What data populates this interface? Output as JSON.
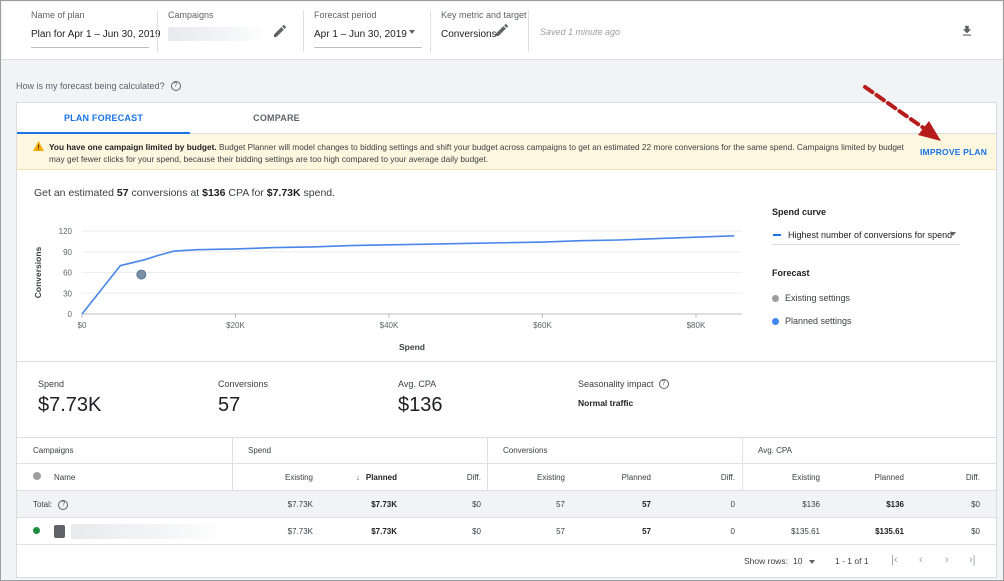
{
  "topbar": {
    "plan_name_label": "Name of plan",
    "plan_name_value": "Plan for Apr 1 – Jun 30, 2019",
    "campaigns_label": "Campaigns",
    "forecast_period_label": "Forecast period",
    "forecast_period_value": "Apr 1 – Jun 30, 2019",
    "key_metric_label": "Key metric and target",
    "key_metric_value": "Conversions",
    "saved_text": "Saved 1 minute ago"
  },
  "how_text": "How is my forecast being calculated?",
  "tabs": [
    {
      "label": "PLAN FORECAST",
      "active": true
    },
    {
      "label": "COMPARE",
      "active": false
    }
  ],
  "warning": {
    "bold": "You have one campaign limited by budget.",
    "text": " Budget Planner will model changes to bidding settings and shift your budget across campaigns to get an estimated 22 more conversions for the same spend. Campaigns limited by budget may get fewer clicks for your spend, because their bidding settings are too high compared to your average daily budget.",
    "action": "IMPROVE PLAN"
  },
  "estimate": {
    "prefix": "Get an estimated ",
    "conversions": "57",
    "mid1": " conversions at ",
    "cpa": "$136",
    "mid2": " CPA for ",
    "spend": "$7.73K",
    "suffix": " spend."
  },
  "chart_data": {
    "type": "line",
    "xlabel": "Spend",
    "ylabel": "Conversions",
    "xlim": [
      0,
      86000
    ],
    "ylim": [
      0,
      120
    ],
    "x_ticks": [
      0,
      20000,
      40000,
      60000,
      80000
    ],
    "x_tick_labels": [
      "$0",
      "$20K",
      "$40K",
      "$60K",
      "$80K"
    ],
    "y_ticks": [
      0,
      30,
      60,
      90,
      120
    ],
    "y_tick_labels": [
      "0",
      "30",
      "60",
      "90",
      "120"
    ],
    "series": [
      {
        "color": "#4a86e8",
        "x": [
          0,
          5000,
          8000,
          10000,
          12000,
          15000,
          20000,
          25000,
          30000,
          35000,
          40000,
          45000,
          50000,
          55000,
          60000,
          65000,
          70000,
          75000,
          80000,
          85000
        ],
        "values": [
          0,
          70,
          78,
          85,
          91,
          93,
          94,
          96,
          97,
          99,
          100,
          101,
          102,
          103,
          104,
          106,
          107,
          109,
          111,
          113
        ]
      }
    ],
    "points": [
      {
        "x": 7730,
        "y": 57,
        "color": "#7a8fa6"
      }
    ]
  },
  "side": {
    "spend_curve_label": "Spend curve",
    "spend_curve_value": "Highest number of conversions for spend",
    "forecast_label": "Forecast",
    "legend": [
      {
        "label": "Existing settings",
        "color": "#9e9e9e"
      },
      {
        "label": "Planned settings",
        "color": "#4285f4"
      }
    ]
  },
  "metrics": {
    "spend_label": "Spend",
    "spend_value": "$7.73K",
    "conv_label": "Conversions",
    "conv_value": "57",
    "cpa_label": "Avg. CPA",
    "cpa_value": "$136",
    "season_label": "Seasonality impact",
    "season_value": "Normal traffic"
  },
  "table": {
    "groups": [
      "Campaigns",
      "Spend",
      "Conversions",
      "Avg. CPA"
    ],
    "name_header": "Name",
    "sub_headers": [
      "Existing",
      "Planned",
      "Diff."
    ],
    "total": {
      "label": "Total:",
      "spend": [
        "$7.73K",
        "$7.73K",
        "$0"
      ],
      "conv": [
        "57",
        "57",
        "0"
      ],
      "cpa": [
        "$136",
        "$136",
        "$0"
      ]
    },
    "row": {
      "spend": [
        "$7.73K",
        "$7.73K",
        "$0"
      ],
      "conv": [
        "57",
        "57",
        "0"
      ],
      "cpa": [
        "$135.61",
        "$135.61",
        "$0"
      ]
    }
  },
  "footer": {
    "show_rows_label": "Show rows:",
    "show_rows_value": "10",
    "range": "1 - 1 of 1"
  },
  "colors": {
    "accent": "#1a73e8",
    "warning_bg": "#fef7e0",
    "warning_icon": "#f9ab00",
    "annotation_arrow": "#b71c1c",
    "status_green": "#1e8e3e"
  }
}
